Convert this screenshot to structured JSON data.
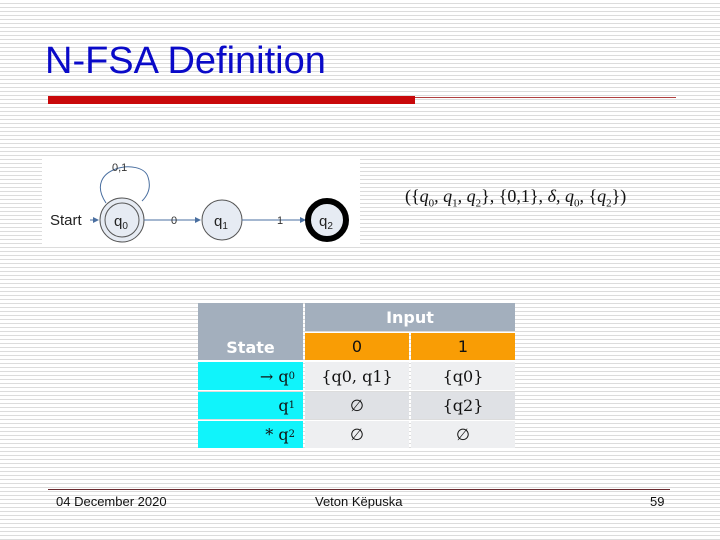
{
  "title": "N-FSA Definition",
  "diagram": {
    "start_label": "Start",
    "states": [
      "q0",
      "q1",
      "q2"
    ],
    "loop_label": "0,1",
    "edge_q0_q1": "0",
    "edge_q1_q2": "1",
    "accepting_state": "q2"
  },
  "tuple": {
    "open": "({",
    "q0": "q",
    "s0": "0",
    "q1": "q",
    "s1": "1",
    "q2": "q",
    "s2": "2",
    "mid1": "}, {0,1}, ",
    "delta": "δ",
    "comma": ", ",
    "q0b": "q",
    "s0b": "0",
    "mid2": ", {",
    "q2b": "q",
    "s2b": "2",
    "close": "})"
  },
  "table": {
    "state_header": "State",
    "input_header": "Input",
    "inputs": [
      "0",
      "1"
    ],
    "rows": [
      {
        "prefix": "→ q",
        "sub": "0",
        "c0": "{q0, q1}",
        "c1": "{q0}"
      },
      {
        "prefix": "q",
        "sub": "1",
        "c0": "∅",
        "c1": "{q2}"
      },
      {
        "prefix": "* q",
        "sub": "2",
        "c0": "∅",
        "c1": "∅"
      }
    ]
  },
  "footer": {
    "date": "04 December 2020",
    "author": "Veton Këpuska",
    "page": "59"
  },
  "colors": {
    "title": "#0a0ac8",
    "accent_bar": "#c8080a",
    "header": "#a3afbd",
    "input_header": "#f99d05",
    "state_cell": "#10f4fb"
  }
}
